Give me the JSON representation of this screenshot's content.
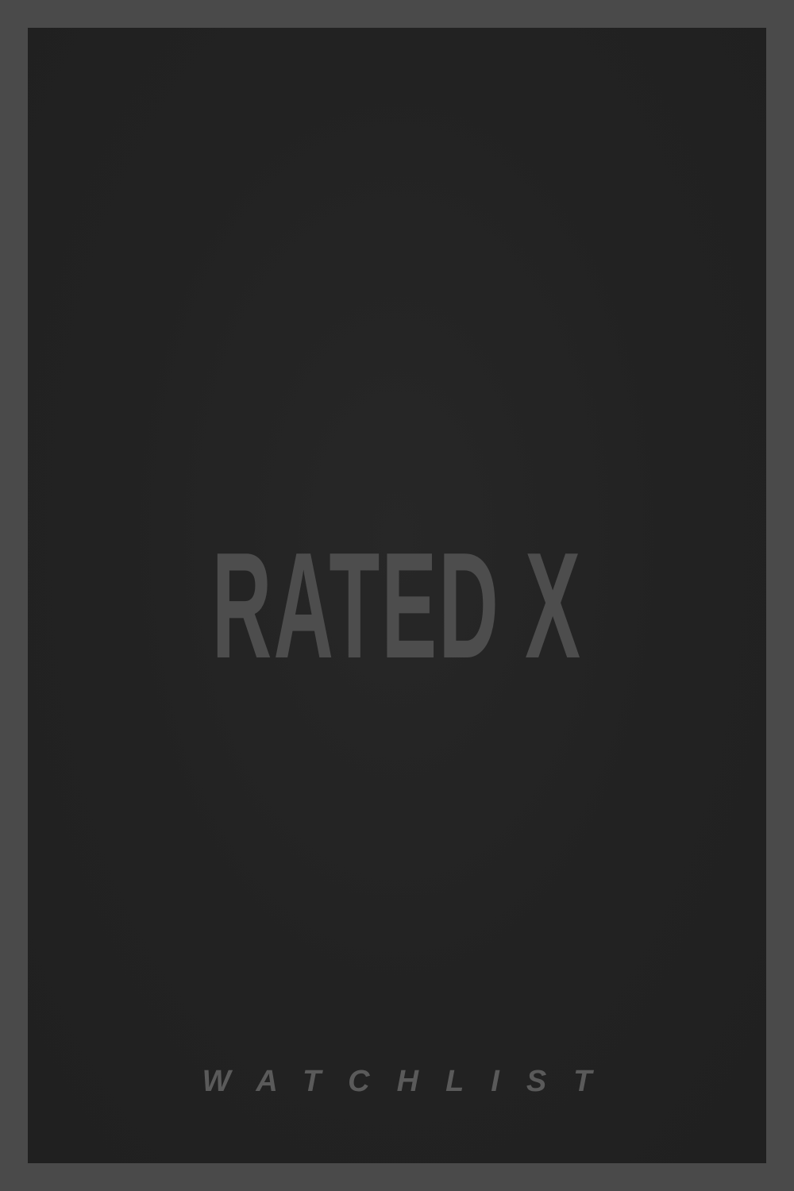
{
  "poster": {
    "title": "RATED X",
    "footer": "WATCHLIST"
  },
  "colors": {
    "border": "#4a4a4a",
    "background": "#222222",
    "title_text": "#4d4d4d",
    "footer_text": "#5a5a5a"
  }
}
